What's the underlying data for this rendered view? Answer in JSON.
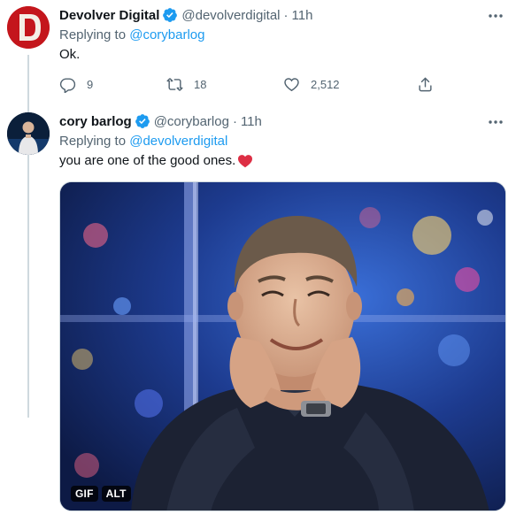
{
  "tweets": [
    {
      "display_name": "Devolver Digital",
      "handle": "@devolverdigital",
      "separator": "·",
      "time": "11h",
      "replying_label": "Replying to",
      "replying_to": "@corybarlog",
      "text": "Ok.",
      "actions": {
        "replies": "9",
        "retweets": "18",
        "likes": "2,512"
      }
    },
    {
      "display_name": "cory barlog",
      "handle": "@corybarlog",
      "separator": "·",
      "time": "11h",
      "replying_label": "Replying to",
      "replying_to": "@devolverdigital",
      "text": "you are one of the good ones.",
      "emoji": "red-heart",
      "media": {
        "type": "gif",
        "gif_badge": "GIF",
        "alt_badge": "ALT"
      }
    }
  ],
  "colors": {
    "link": "#1d9bf0",
    "secondary_text": "#536471",
    "verified": "#1d9bf0",
    "heart": "#e0245e"
  },
  "icons": [
    "more-icon",
    "verified-icon",
    "reply-icon",
    "retweet-icon",
    "like-icon",
    "share-icon",
    "heart-emoji"
  ]
}
